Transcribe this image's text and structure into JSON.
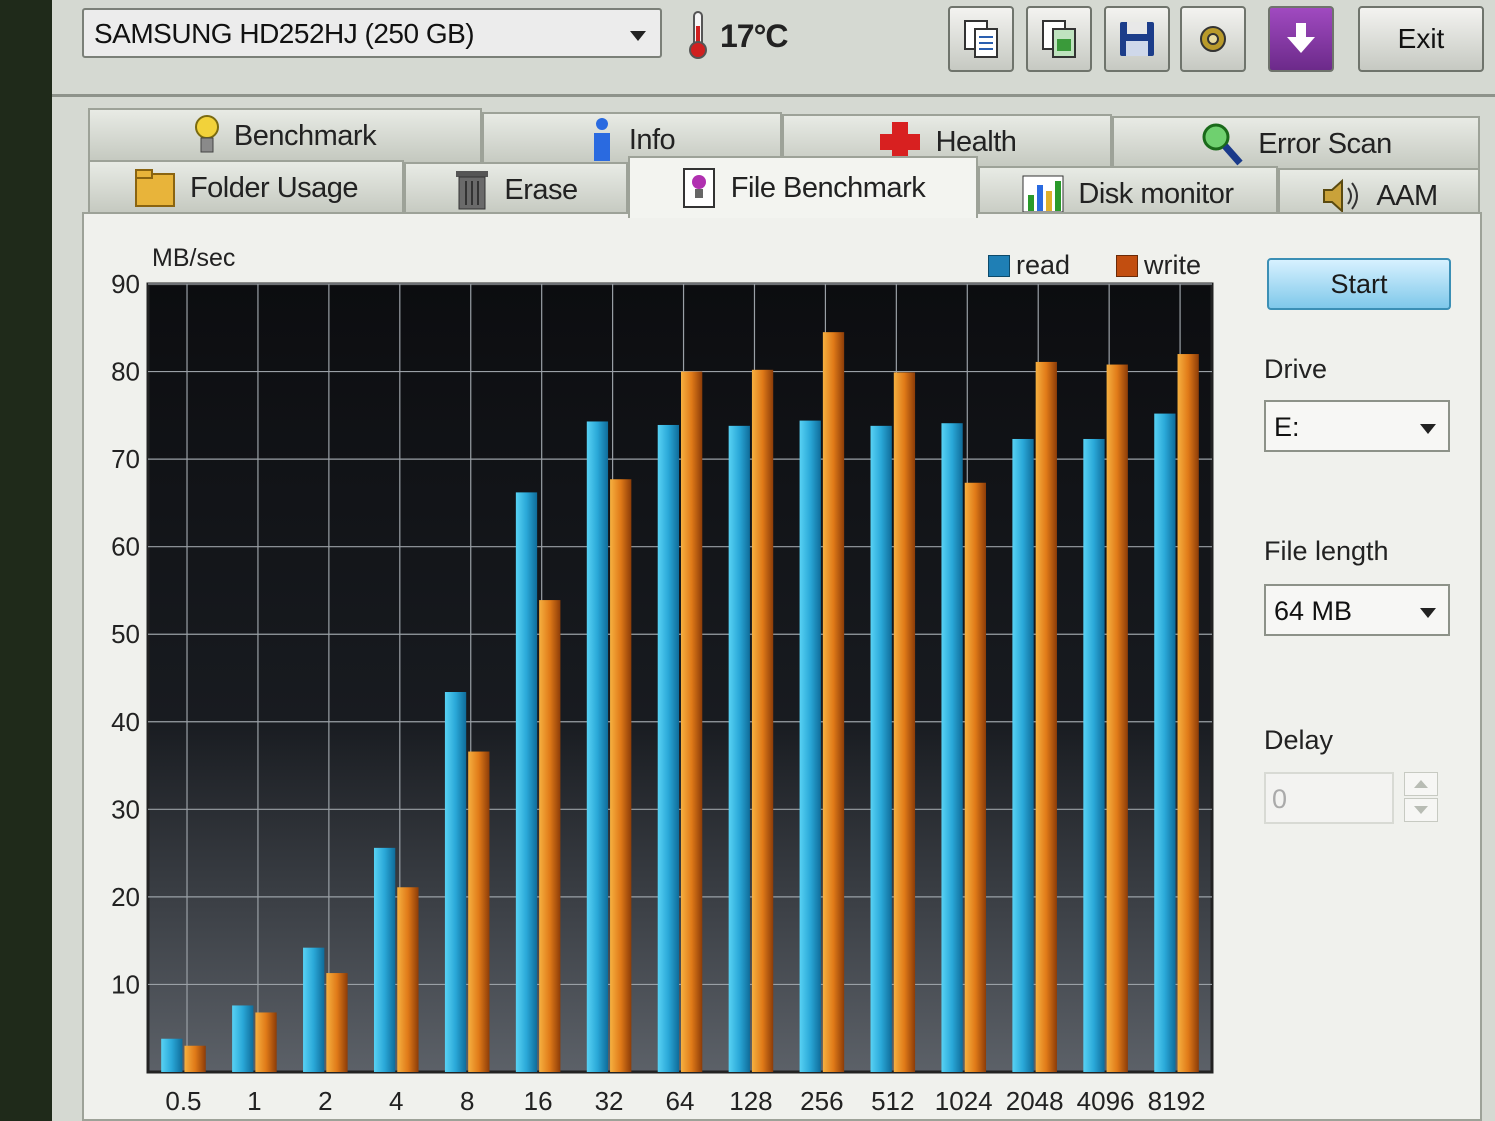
{
  "toolbar": {
    "drive": "SAMSUNG HD252HJ (250 GB)",
    "temperature": "17°C",
    "exit_label": "Exit"
  },
  "tabs_row1": [
    {
      "label": "Benchmark",
      "icon": "bulb-icon"
    },
    {
      "label": "Info",
      "icon": "info-icon"
    },
    {
      "label": "Health",
      "icon": "cross-icon"
    },
    {
      "label": "Error Scan",
      "icon": "magnifier-icon"
    }
  ],
  "tabs_row2": [
    {
      "label": "Folder Usage",
      "icon": "folder-icon"
    },
    {
      "label": "Erase",
      "icon": "trash-icon"
    },
    {
      "label": "File Benchmark",
      "icon": "file-benchmark-icon",
      "active": true
    },
    {
      "label": "Disk monitor",
      "icon": "bar-chart-icon"
    },
    {
      "label": "AAM",
      "icon": "speaker-icon"
    }
  ],
  "side": {
    "start_label": "Start",
    "drive_label": "Drive",
    "drive_value": "E:",
    "file_length_label": "File length",
    "file_length_value": "64 MB",
    "delay_label": "Delay",
    "delay_value": "0"
  },
  "chart_data": {
    "type": "bar",
    "ylabel": "MB/sec",
    "ylim": [
      0,
      90
    ],
    "yticks": [
      10,
      20,
      30,
      40,
      50,
      60,
      70,
      80,
      90
    ],
    "categories": [
      "0.5",
      "1",
      "2",
      "4",
      "8",
      "16",
      "32",
      "64",
      "128",
      "256",
      "512",
      "1024",
      "2048",
      "4096",
      "8192"
    ],
    "series": [
      {
        "name": "read",
        "color": "#2aa8d8",
        "values": [
          3.8,
          7.6,
          14.2,
          25.6,
          43.4,
          66.2,
          74.3,
          73.9,
          73.8,
          74.4,
          73.8,
          74.1,
          72.3,
          72.3,
          75.2
        ]
      },
      {
        "name": "write",
        "color": "#e07a18",
        "values": [
          3.0,
          6.8,
          11.3,
          21.1,
          36.6,
          53.9,
          67.7,
          80.0,
          80.2,
          84.5,
          79.9,
          67.3,
          81.1,
          80.8,
          82.0
        ]
      }
    ],
    "legend_position": "top-right",
    "grid": true
  }
}
